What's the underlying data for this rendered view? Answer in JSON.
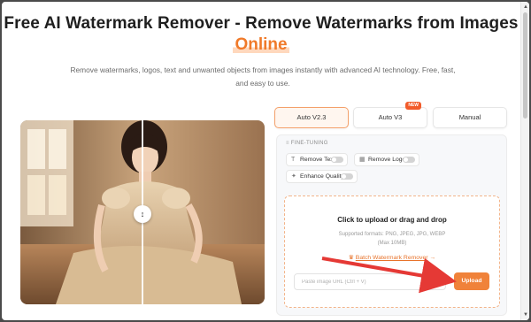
{
  "header": {
    "title": "Free AI Watermark Remover - Remove Watermarks from Images",
    "title_accent": "Online",
    "subtitle": "Remove watermarks, logos, text and unwanted objects from images instantly with advanced AI technology. Free, fast, and easy to use."
  },
  "mode_tabs": [
    {
      "label": "Auto V2.3",
      "active": true
    },
    {
      "label": "Auto V3",
      "badge": "NEW"
    },
    {
      "label": "Manual"
    }
  ],
  "fine_tuning": {
    "label": "FINE-TUNING",
    "options": [
      {
        "label": "Remove Text",
        "icon": "text-icon",
        "enabled": false
      },
      {
        "label": "Remove Logo",
        "icon": "logo-icon",
        "enabled": false
      },
      {
        "label": "Enhance Quality",
        "icon": "sparkle-icon",
        "enabled": false
      }
    ]
  },
  "upload": {
    "title": "Click to upload or drag and drop",
    "formats": "Supported formats: PNG, JPEG, JPG, WEBP",
    "max_size": "(Max 10MB)",
    "batch_link": "Batch Watermark Remover",
    "url_placeholder": "Paste image URL (Ctrl + V)",
    "button_label": "Upload"
  },
  "colors": {
    "accent": "#f07a2a",
    "annotation_arrow": "#e53935"
  }
}
